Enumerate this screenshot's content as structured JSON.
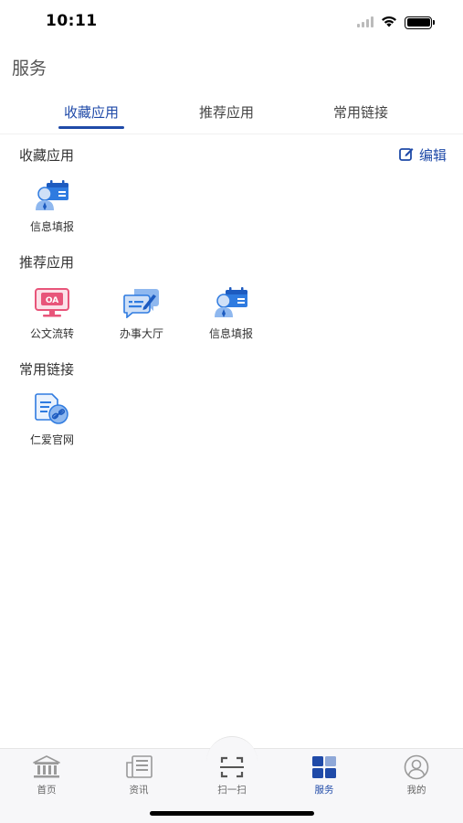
{
  "status_bar": {
    "time": "10:11"
  },
  "page": {
    "title": "服务"
  },
  "tabs": [
    {
      "label": "收藏应用",
      "active": true
    },
    {
      "label": "推荐应用",
      "active": false
    },
    {
      "label": "常用链接",
      "active": false
    }
  ],
  "favorites": {
    "title": "收藏应用",
    "edit_label": "编辑",
    "apps": [
      {
        "label": "信息填报",
        "icon": "info-report-icon"
      }
    ]
  },
  "recommended": {
    "title": "推荐应用",
    "apps": [
      {
        "label": "公文流转",
        "icon": "oa-monitor-icon",
        "badge": "OA"
      },
      {
        "label": "办事大厅",
        "icon": "chat-bubbles-icon"
      },
      {
        "label": "信息填报",
        "icon": "info-report-icon"
      }
    ]
  },
  "links": {
    "title": "常用链接",
    "apps": [
      {
        "label": "仁爱官网",
        "icon": "link-document-icon"
      }
    ]
  },
  "bottom_nav": [
    {
      "label": "首页",
      "icon": "bank-icon",
      "active": false
    },
    {
      "label": "资讯",
      "icon": "news-icon",
      "active": false
    },
    {
      "label": "扫一扫",
      "icon": "scan-icon",
      "active": false
    },
    {
      "label": "服务",
      "icon": "grid-icon",
      "active": true
    },
    {
      "label": "我的",
      "icon": "user-icon",
      "active": false
    }
  ],
  "colors": {
    "accent": "#1f4aa8",
    "oa_pink": "#e8557a",
    "icon_blue": "#2f7be0"
  }
}
